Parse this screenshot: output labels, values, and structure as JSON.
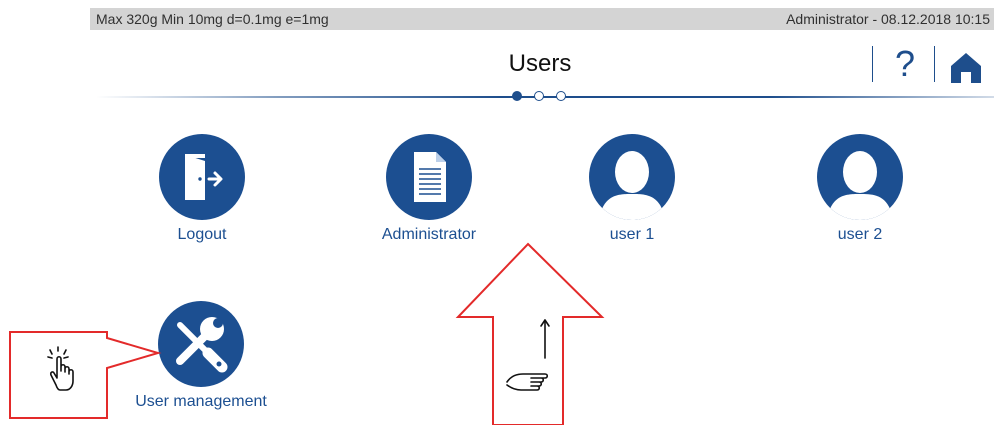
{
  "status": {
    "specs": "Max 320g  Min 10mg  d=0.1mg  e=1mg",
    "user_datetime": "Administrator  -  08.12.2018 10:15"
  },
  "header": {
    "title": "Users",
    "help_icon": "question-mark-icon",
    "home_icon": "home-icon",
    "page_indicator": {
      "pages": 3,
      "current": 1
    }
  },
  "tiles": [
    {
      "label": "Logout",
      "icon": "logout-door-icon"
    },
    {
      "label": "Administrator",
      "icon": "document-icon"
    },
    {
      "label": "user 1",
      "icon": "user-avatar-icon"
    },
    {
      "label": "user 2",
      "icon": "user-avatar-icon"
    },
    {
      "label": "User management",
      "icon": "tools-icon"
    }
  ],
  "annotations": {
    "tap_icon": "tap-gesture-icon",
    "swipe_icon": "swipe-up-gesture-icon",
    "arrow_color": "#e32a2a",
    "accent": "#1c4f91"
  }
}
